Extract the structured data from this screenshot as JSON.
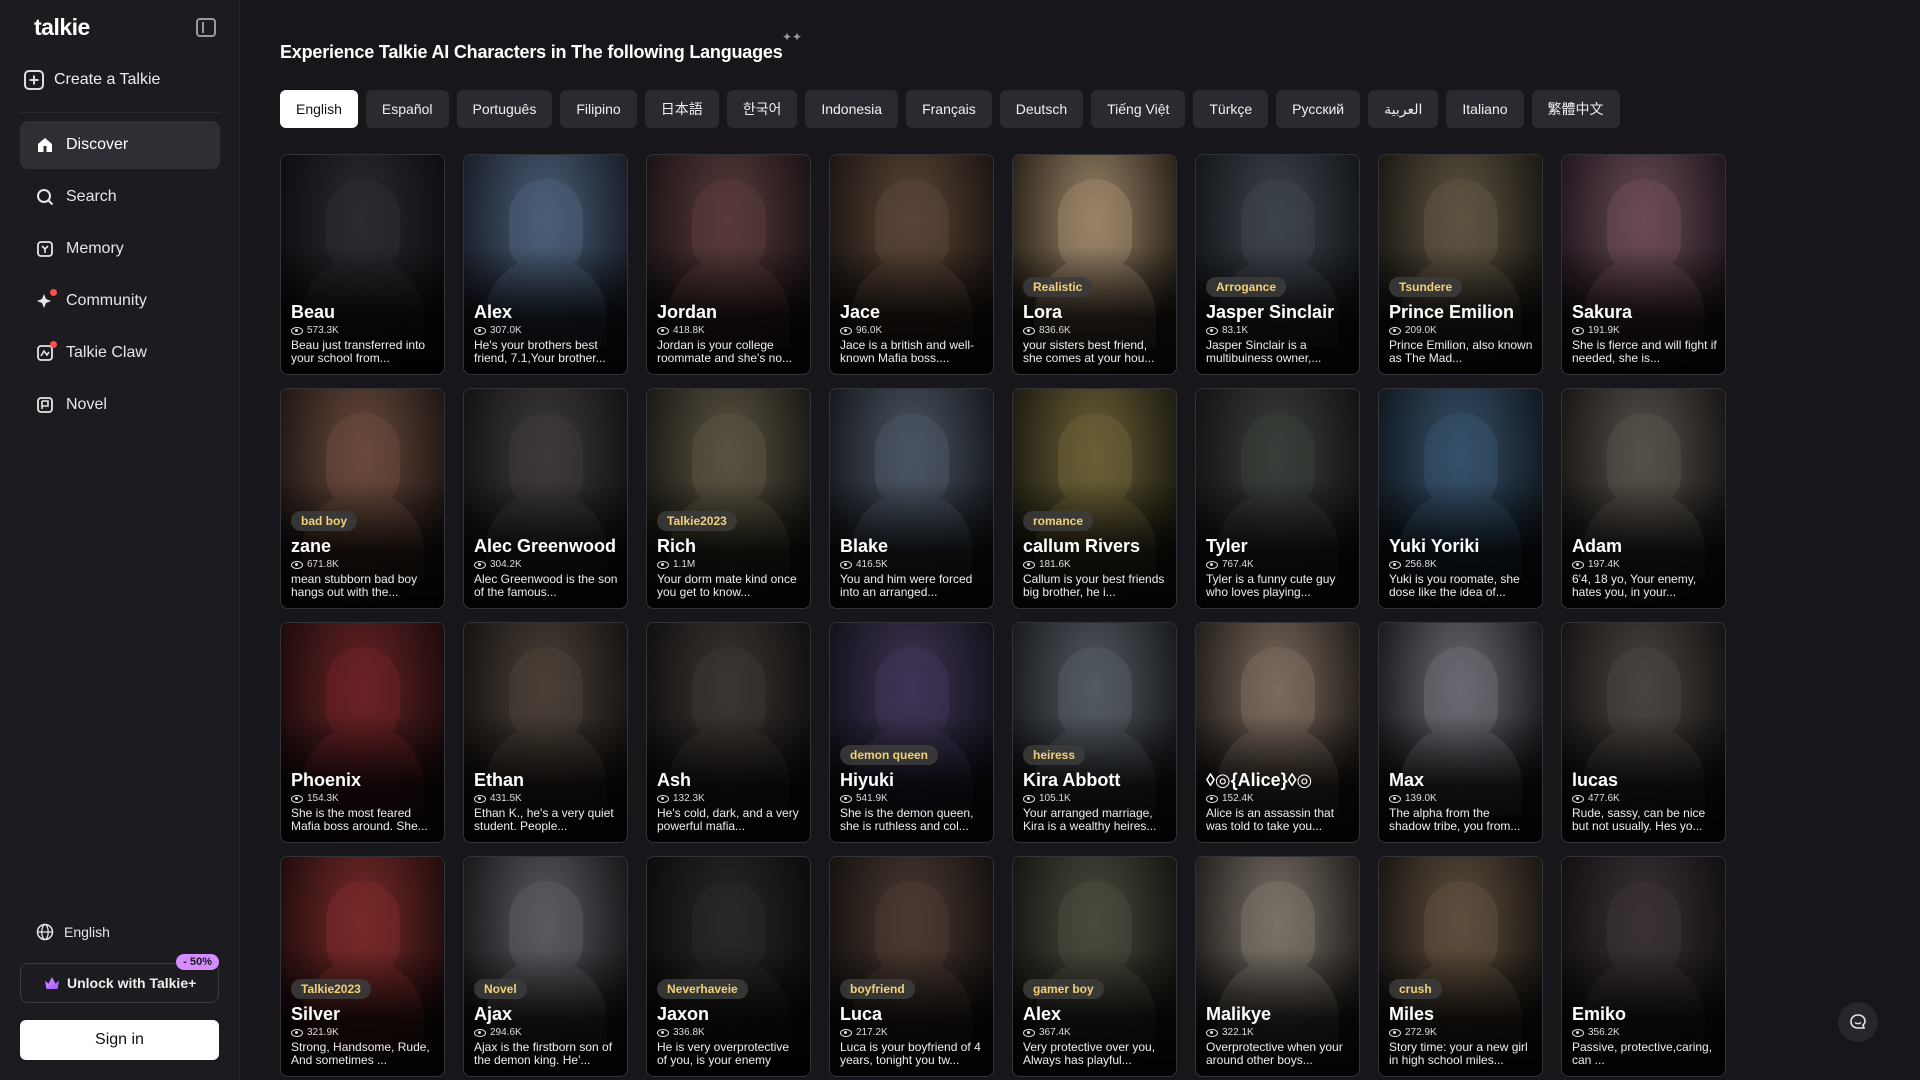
{
  "app": {
    "logo": "talkie"
  },
  "sidebar": {
    "create_label": "Create a Talkie",
    "items": [
      {
        "label": "Discover",
        "icon": "home-icon",
        "active": true
      },
      {
        "label": "Search",
        "icon": "search-icon"
      },
      {
        "label": "Memory",
        "icon": "memory-icon"
      },
      {
        "label": "Community",
        "icon": "sparkle-icon",
        "dot": true
      },
      {
        "label": "Talkie Claw",
        "icon": "claw-icon",
        "dot": true
      },
      {
        "label": "Novel",
        "icon": "book-icon"
      }
    ],
    "language": "English",
    "unlock_label": "Unlock with Talkie+",
    "discount": "- 50%",
    "sign_in": "Sign in"
  },
  "main": {
    "title": "Experience Talkie AI Characters in The following Languages",
    "tabs": [
      "English",
      "Español",
      "Português",
      "Filipino",
      "日本語",
      "한국어",
      "Indonesia",
      "Français",
      "Deutsch",
      "Tiếng Việt",
      "Türkçe",
      "Русский",
      "العربية",
      "Italiano",
      "繁體中文"
    ],
    "active_tab": "English"
  },
  "cards": [
    {
      "name": "Beau",
      "tag": "",
      "views": "573.3K",
      "desc": "Beau just transferred into your school from...",
      "colors": [
        "#2b2b30",
        "#0e0e12"
      ]
    },
    {
      "name": "Alex",
      "tag": "",
      "views": "307.0K",
      "desc": "He's your brothers best friend, 7.1,Your brother...",
      "colors": [
        "#4b5e78",
        "#1a1f2a"
      ]
    },
    {
      "name": "Jordan",
      "tag": "",
      "views": "418.8K",
      "desc": "Jordan is your college roommate and she's no...",
      "colors": [
        "#5a3a3a",
        "#1c1416"
      ]
    },
    {
      "name": "Jace",
      "tag": "",
      "views": "96.0K",
      "desc": "Jace is a british and well-known Mafia boss....",
      "colors": [
        "#5a4536",
        "#1d1713"
      ]
    },
    {
      "name": "Lora",
      "tag": "Realistic",
      "views": "836.6K",
      "desc": "your sisters best friend, she comes at your hou...",
      "colors": [
        "#9a8468",
        "#2d251c"
      ]
    },
    {
      "name": "Jasper Sinclair",
      "tag": "Arrogance",
      "views": "83.1K",
      "desc": "Jasper Sinclair is a multibuiness owner,...",
      "colors": [
        "#3e444c",
        "#14171b"
      ]
    },
    {
      "name": "Prince Emilion",
      "tag": "Tsundere",
      "views": "209.0K",
      "desc": "Prince Emilion, also known as The Mad...",
      "colors": [
        "#5e5442",
        "#1d1a14"
      ]
    },
    {
      "name": "Sakura",
      "tag": "",
      "views": "191.9K",
      "desc": "She is fierce and will fight if needed, she is...",
      "colors": [
        "#6b4a55",
        "#221820"
      ]
    },
    {
      "name": "zane",
      "tag": "bad boy",
      "views": "671.8K",
      "desc": "mean stubborn bad boy hangs out with the...",
      "colors": [
        "#6a4a3c",
        "#211815"
      ]
    },
    {
      "name": "Alec Greenwood",
      "tag": "",
      "views": "304.2K",
      "desc": "Alec Greenwood is the son of the famous...",
      "colors": [
        "#3e3a3a",
        "#141313"
      ]
    },
    {
      "name": "Rich",
      "tag": "Talkie2023",
      "views": "1.1M",
      "desc": "Your dorm mate kind once you get to know...",
      "colors": [
        "#5a5342",
        "#1c1a15"
      ]
    },
    {
      "name": "Blake",
      "tag": "",
      "views": "416.5K",
      "desc": "You and him were forced into an arranged...",
      "colors": [
        "#4b5563",
        "#171a1f"
      ]
    },
    {
      "name": "callum Rivers",
      "tag": "romance",
      "views": "181.6K",
      "desc": "Callum is your best friends big brother, he i...",
      "colors": [
        "#6a6036",
        "#201d12"
      ]
    },
    {
      "name": "Tyler",
      "tag": "",
      "views": "767.4K",
      "desc": "Tyler is a funny cute guy who loves playing...",
      "colors": [
        "#3a3e3a",
        "#131413"
      ]
    },
    {
      "name": "Yuki Yoriki",
      "tag": "",
      "views": "256.8K",
      "desc": "Yuki is you roomate, she dose like the idea of...",
      "colors": [
        "#35506a",
        "#121a22"
      ]
    },
    {
      "name": "Adam",
      "tag": "",
      "views": "197.4K",
      "desc": "6'4, 18 yo, Your enemy, hates you, in your...",
      "colors": [
        "#56504a",
        "#1a1816"
      ]
    },
    {
      "name": "Phoenix",
      "tag": "",
      "views": "154.3K",
      "desc": "She is the most feared Mafia boss around. She...",
      "colors": [
        "#6a2226",
        "#1e0c0d"
      ]
    },
    {
      "name": "Ethan",
      "tag": "",
      "views": "431.5K",
      "desc": "Ethan K., he's a very quiet student. People...",
      "colors": [
        "#4a4038",
        "#181412"
      ]
    },
    {
      "name": "Ash",
      "tag": "",
      "views": "132.3K",
      "desc": "He's cold, dark, and a very powerful mafia...",
      "colors": [
        "#3c3632",
        "#121010"
      ]
    },
    {
      "name": "Hiyuki",
      "tag": "demon queen",
      "views": "541.9K",
      "desc": "She is the demon queen, she is ruthless and col...",
      "colors": [
        "#3e3456",
        "#15121c"
      ]
    },
    {
      "name": "Kira Abbott",
      "tag": "heiress",
      "views": "105.1K",
      "desc": "Your arranged marriage, Kira is a wealthy heires...",
      "colors": [
        "#545a62",
        "#1a1c1f"
      ]
    },
    {
      "name": "◊◎{Alice}◊◎",
      "tag": "",
      "views": "152.4K",
      "desc": "Alice is an assassin that was told to take you...",
      "colors": [
        "#7a6a5e",
        "#241f1b"
      ]
    },
    {
      "name": "Max",
      "tag": "",
      "views": "139.0K",
      "desc": "The alpha from the shadow tribe, you from...",
      "colors": [
        "#6a6a72",
        "#1c1c20"
      ]
    },
    {
      "name": "lucas",
      "tag": "",
      "views": "477.6K",
      "desc": "Rude, sassy, can be nice but not usually. Hes yo...",
      "colors": [
        "#4a4440",
        "#171514"
      ]
    },
    {
      "name": "Silver",
      "tag": "Talkie2023",
      "views": "321.9K",
      "desc": "Strong, Handsome, Rude, And sometimes ...",
      "colors": [
        "#7a2a2a",
        "#220d0d"
      ]
    },
    {
      "name": "Ajax",
      "tag": "Novel",
      "views": "294.6K",
      "desc": "Ajax is the firstborn son of the demon king. He'...",
      "colors": [
        "#5a5a60",
        "#1a1a1d"
      ]
    },
    {
      "name": "Jaxon",
      "tag": "Neverhaveie",
      "views": "336.8K",
      "desc": "He is very overprotective of you, is your enemy",
      "colors": [
        "#2a2826",
        "#0d0c0c"
      ]
    },
    {
      "name": "Luca",
      "tag": "boyfriend",
      "views": "217.2K",
      "desc": "Luca is your boyfriend of 4 years, tonight you tw...",
      "colors": [
        "#4a3a32",
        "#171210"
      ]
    },
    {
      "name": "Alex",
      "tag": "gamer boy",
      "views": "367.4K",
      "desc": "Very protective over you, Always has playful...",
      "colors": [
        "#4a4a3e",
        "#171713"
      ]
    },
    {
      "name": "Malikye",
      "tag": "",
      "views": "322.1K",
      "desc": "Overprotective when your around other boys...",
      "colors": [
        "#7a7268",
        "#24211e"
      ]
    },
    {
      "name": "Miles",
      "tag": "crush",
      "views": "272.9K",
      "desc": "Story time: your a new girl in high school miles...",
      "colors": [
        "#5e4e3e",
        "#1c1713"
      ]
    },
    {
      "name": "Emiko",
      "tag": "",
      "views": "356.2K",
      "desc": "Passive, protective,caring, can ...",
      "colors": [
        "#3a3236",
        "#131012"
      ]
    }
  ]
}
